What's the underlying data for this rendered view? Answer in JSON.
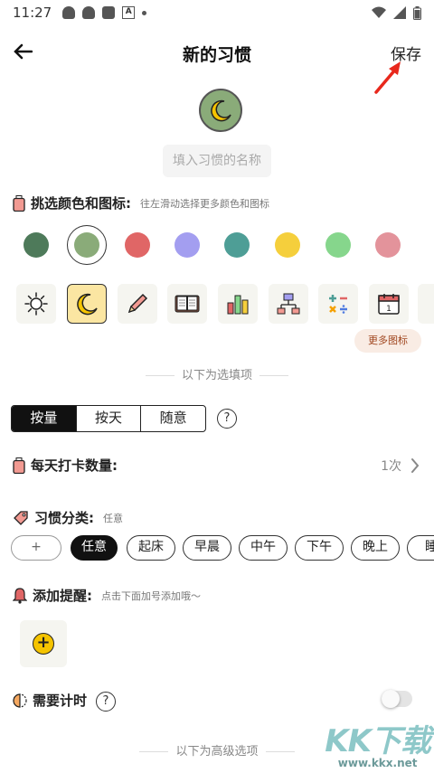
{
  "status_bar": {
    "time": "11:27"
  },
  "header": {
    "back_icon": "arrow-left-icon",
    "title": "新的习惯",
    "save_label": "保存"
  },
  "habit": {
    "icon": "moon-icon",
    "color": "#8aab79",
    "name_placeholder": "填入习惯的名称"
  },
  "color_icon_section": {
    "title": "挑选颜色和图标:",
    "hint": "往左滑动选择更多颜色和图标",
    "colors": [
      "#4e7a5a",
      "#8aab79",
      "#e06666",
      "#a39ef0",
      "#4e9e96",
      "#f5cf3c",
      "#86d68c",
      "#e3939b"
    ],
    "selected_color_index": 1,
    "icons": [
      "sun-icon",
      "moon-icon",
      "pencil-icon",
      "book-icon",
      "bar-chart-icon",
      "network-icon",
      "calculator-icon",
      "calendar-icon"
    ],
    "selected_icon_index": 1,
    "calendar_number": "1",
    "more_icons_label": "更多图标"
  },
  "optional_divider": "以下为选填项",
  "mode_tabs": {
    "items": [
      "按量",
      "按天",
      "随意"
    ],
    "selected_index": 0,
    "help": "?"
  },
  "daily_count": {
    "title": "每天打卡数量:",
    "value": "1次"
  },
  "category": {
    "title": "习惯分类:",
    "current": "任意",
    "add_label": "+",
    "chips": [
      "任意",
      "起床",
      "早晨",
      "中午",
      "下午",
      "晚上",
      "睡"
    ],
    "selected_index": 0
  },
  "reminder": {
    "title": "添加提醒:",
    "hint": "点击下面加号添加哦～",
    "add_label": "+"
  },
  "timer": {
    "title": "需要计时",
    "help": "?",
    "enabled": false
  },
  "advanced_divider": "以下为高级选项",
  "watermark": {
    "brand": "KK下载",
    "url": "www.kkx.net"
  }
}
